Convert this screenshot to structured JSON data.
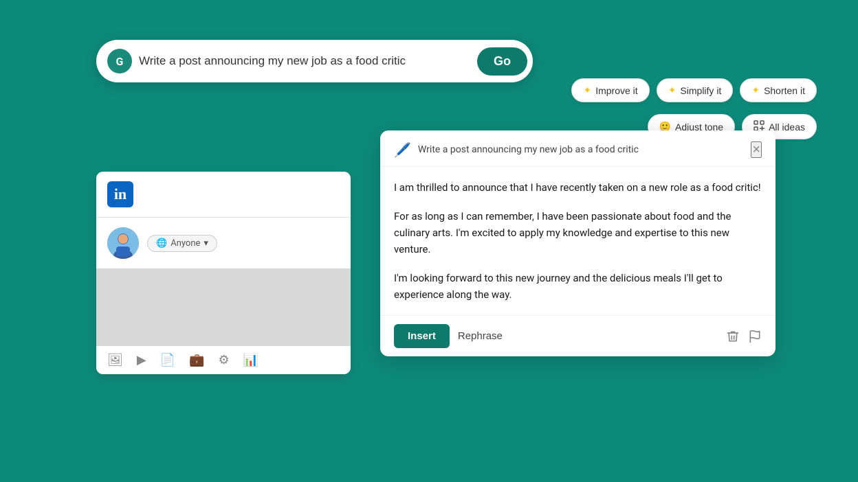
{
  "background_color": "#0d8a7a",
  "search_bar": {
    "placeholder": "Write a post announcing my new job as a food critic",
    "go_label": "Go",
    "icon_letter": "G"
  },
  "linkedin_card": {
    "logo_text": "in",
    "audience_label": "Anyone",
    "toolbar_icons": [
      "image",
      "video",
      "document",
      "briefcase",
      "star",
      "chart"
    ]
  },
  "response_panel": {
    "close_label": "×",
    "prompt_text": "Write a post announcing my new job as a food critic",
    "body_paragraphs": [
      "I am thrilled to announce that I have recently taken on a new role as a food critic!",
      "For as long as I can remember, I have been passionate about food and the culinary arts. I'm excited to apply my knowledge and expertise to this new venture.",
      "I'm looking forward to this new journey and the delicious meals I'll get to experience along the way."
    ],
    "insert_label": "Insert",
    "rephrase_label": "Rephrase"
  },
  "suggestions": {
    "row1": [
      {
        "label": "Improve it",
        "icon": "✦"
      },
      {
        "label": "Simplify it",
        "icon": "✦"
      },
      {
        "label": "Shorten it",
        "icon": "✦"
      }
    ],
    "row2": [
      {
        "label": "Adjust tone",
        "icon": "😊"
      },
      {
        "label": "All ideas",
        "icon": "⊞"
      }
    ]
  }
}
